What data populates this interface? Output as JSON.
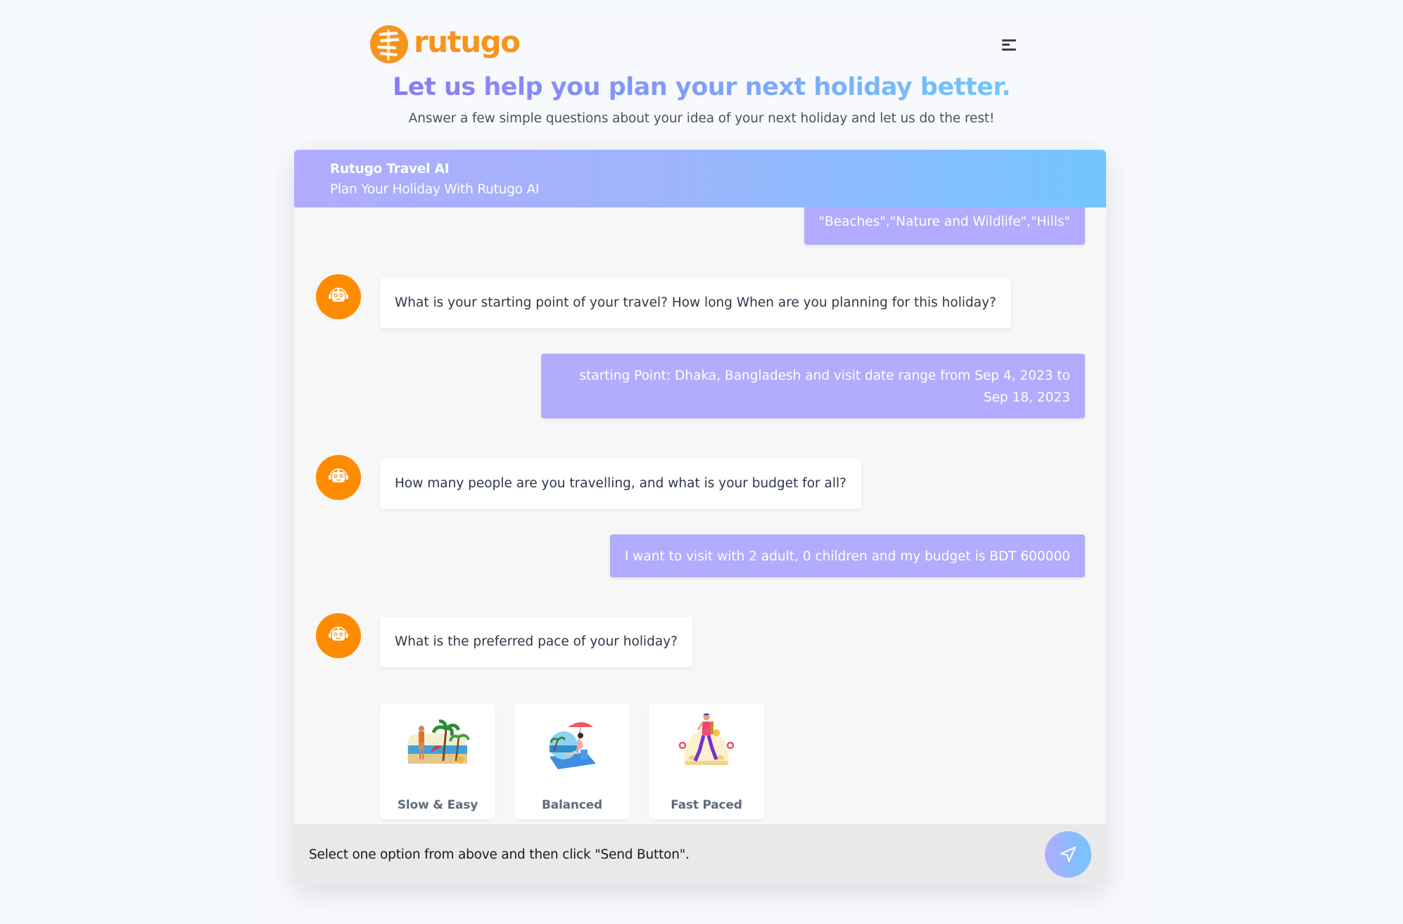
{
  "brand": {
    "name": "rutugo",
    "color": "#f7941d",
    "logo_icon": "signpost-icon"
  },
  "nav": {
    "menu_icon": "hamburger-menu-icon"
  },
  "hero": {
    "title": "Let us help you plan your next holiday better.",
    "subtitle": "Answer a few simple questions about your idea of your next holiday and let us do the rest!",
    "gradient": [
      "#8b7af6",
      "#6ec9fc"
    ]
  },
  "chat": {
    "header": {
      "title": "Rutugo Travel AI",
      "subtitle": "Plan Your Holiday With Rutugo AI"
    },
    "messages": [
      {
        "role": "user",
        "text": "\"Beaches\",\"Nature and Wildlife\",\"Hills\""
      },
      {
        "role": "bot",
        "avatar_icon": "robot-icon",
        "text": "What is your starting point of your travel? How long When are you planning for this holiday?"
      },
      {
        "role": "user",
        "text_lines": [
          "starting Point: Dhaka, Bangladesh and visit date range from Sep 4, 2023 to",
          "Sep 18, 2023"
        ]
      },
      {
        "role": "bot",
        "avatar_icon": "robot-icon",
        "text": "How many people are you travelling, and what is your budget for all?"
      },
      {
        "role": "user",
        "text": "I want to visit with 2 adult, 0 children and my budget is BDT 600000"
      },
      {
        "role": "bot",
        "avatar_icon": "robot-icon",
        "text": "What is the preferred pace of your holiday?"
      }
    ],
    "options": [
      {
        "label": "Slow & Easy",
        "illustration": "beach-relax-illustration"
      },
      {
        "label": "Balanced",
        "illustration": "beach-umbrella-illustration"
      },
      {
        "label": "Fast Paced",
        "illustration": "walking-traveler-illustration"
      }
    ],
    "input": {
      "value": "Select one option from above and then click \"Send Button\".",
      "send_icon": "send-icon"
    },
    "colors": {
      "user_bubble": "#b1acfd",
      "bot_avatar": "#ff8c00",
      "header_gradient": [
        "#b1acfd",
        "#74c5fd"
      ]
    }
  }
}
